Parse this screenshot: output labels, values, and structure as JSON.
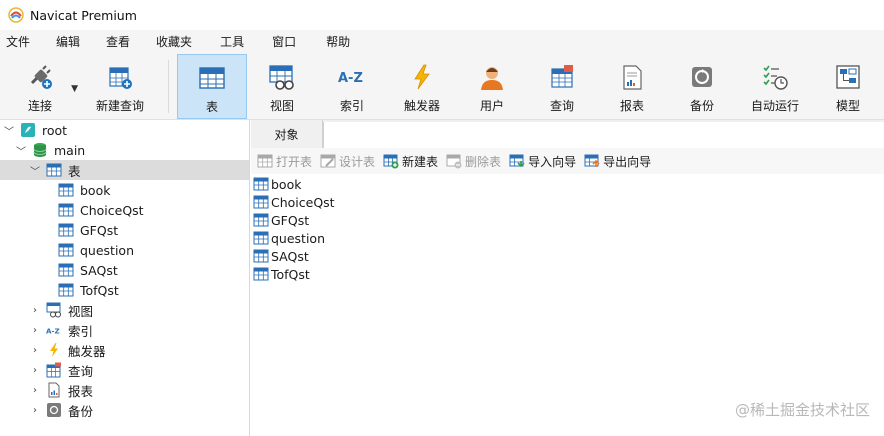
{
  "window": {
    "title": "Navicat Premium"
  },
  "menu": [
    "文件",
    "编辑",
    "查看",
    "收藏夹",
    "工具",
    "窗口",
    "帮助"
  ],
  "toolbar": {
    "items": [
      {
        "label": "连接",
        "icon": "plug-icon"
      },
      {
        "label": "新建查询",
        "icon": "new-query-icon"
      },
      {
        "label": "表",
        "icon": "table-icon",
        "active": true
      },
      {
        "label": "视图",
        "icon": "view-icon"
      },
      {
        "label": "索引",
        "icon": "index-icon"
      },
      {
        "label": "触发器",
        "icon": "trigger-icon"
      },
      {
        "label": "用户",
        "icon": "user-icon"
      },
      {
        "label": "查询",
        "icon": "query-icon"
      },
      {
        "label": "报表",
        "icon": "report-icon"
      },
      {
        "label": "备份",
        "icon": "backup-icon"
      },
      {
        "label": "自动运行",
        "icon": "schedule-icon"
      },
      {
        "label": "模型",
        "icon": "model-icon"
      }
    ]
  },
  "tree": {
    "connection": "root",
    "database": "main",
    "tables_node": "表",
    "tables": [
      "book",
      "ChoiceQst",
      "GFQst",
      "question",
      "SAQst",
      "TofQst"
    ],
    "other_nodes": [
      "视图",
      "索引",
      "触发器",
      "查询",
      "报表",
      "备份"
    ]
  },
  "objects": {
    "tab": "对象",
    "actions": [
      {
        "label": "打开表",
        "enabled": false
      },
      {
        "label": "设计表",
        "enabled": false
      },
      {
        "label": "新建表",
        "enabled": true
      },
      {
        "label": "删除表",
        "enabled": false
      },
      {
        "label": "导入向导",
        "enabled": true
      },
      {
        "label": "导出向导",
        "enabled": true
      }
    ],
    "items": [
      "book",
      "ChoiceQst",
      "GFQst",
      "question",
      "SAQst",
      "TofQst"
    ]
  },
  "watermark": "@稀土掘金技术社区",
  "colors": {
    "accent": "#1e73be",
    "active_tool_bg": "#cce4f7",
    "selection": "#dcdcdc"
  }
}
